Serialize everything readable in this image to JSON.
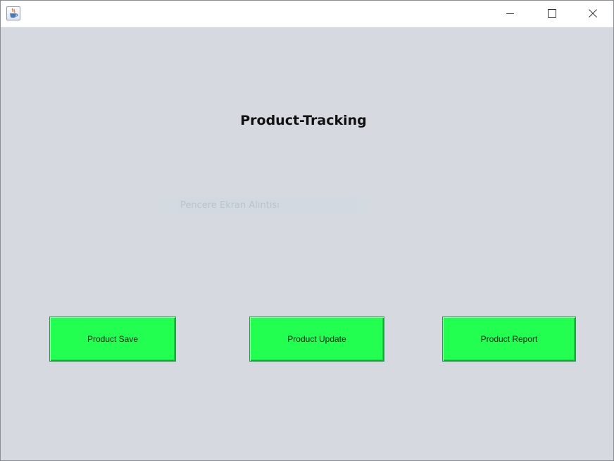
{
  "window": {
    "app_icon": "java-cup-icon",
    "controls": {
      "minimize_icon": "minimize-icon",
      "maximize_icon": "maximize-icon",
      "close_icon": "close-icon"
    }
  },
  "main": {
    "title": "Product-Tracking",
    "ghost_text": "Pencere Ekran Alıntısı",
    "buttons": {
      "save": "Product Save",
      "update": "Product Update",
      "report": "Product Report"
    }
  },
  "colors": {
    "background": "#d6d9df",
    "button_green": "#22ff50",
    "titlebar": "#ffffff"
  }
}
